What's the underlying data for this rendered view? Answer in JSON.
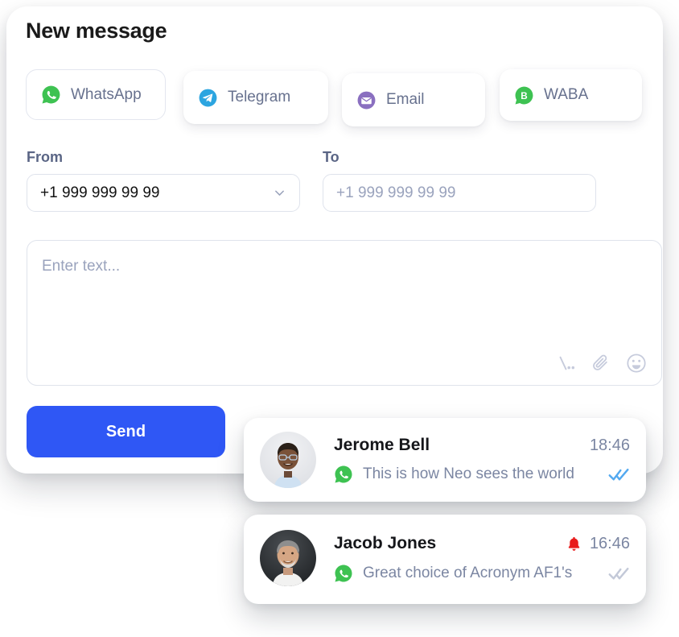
{
  "composer": {
    "title": "New message",
    "tabs": [
      {
        "label": "WhatsApp",
        "icon": "whatsapp-icon",
        "selected": true,
        "color": "#3ec252"
      },
      {
        "label": "Telegram",
        "icon": "telegram-icon",
        "selected": false,
        "color": "#2ca5e0"
      },
      {
        "label": "Email",
        "icon": "email-icon",
        "selected": false,
        "color": "#8a6fc0"
      },
      {
        "label": "WABA",
        "icon": "waba-icon",
        "selected": false,
        "color": "#3ec252"
      }
    ],
    "from": {
      "label": "From",
      "value": "+1 999 999 99 99",
      "chevron_icon": "chevron-down-icon"
    },
    "to": {
      "label": "To",
      "placeholder": "+1 999 999 99 99",
      "value": ""
    },
    "message": {
      "placeholder": "Enter text...",
      "value": "",
      "tools": [
        {
          "icon": "variable-template-icon"
        },
        {
          "icon": "paperclip-icon"
        },
        {
          "icon": "emoji-smile-icon"
        }
      ]
    },
    "send_label": "Send",
    "send_color": "#2f57f5"
  },
  "notifications": [
    {
      "name": "Jerome Bell",
      "time": "18:46",
      "text": "This is how Neo sees the world",
      "channel_icon": "whatsapp-icon",
      "status_icon": "double-check-read-icon",
      "status_color": "#53a9f0",
      "has_bell": false,
      "avatar": "avatar-jerome-bell"
    },
    {
      "name": "Jacob Jones",
      "time": "16:46",
      "text": "Great choice of Acronym AF1's",
      "channel_icon": "whatsapp-icon",
      "status_icon": "double-check-delivered-icon",
      "status_color": "#c3c9d8",
      "has_bell": true,
      "bell_icon": "bell-alert-icon",
      "bell_color": "#e81c1c",
      "avatar": "avatar-jacob-jones"
    }
  ]
}
